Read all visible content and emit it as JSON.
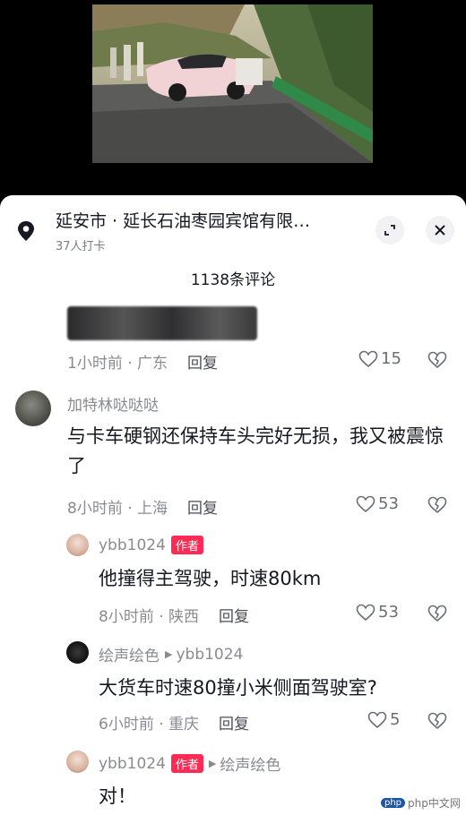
{
  "location": {
    "title": "延安市 · 延长石油枣园宾馆有限…",
    "subtitle": "37人打卡"
  },
  "comment_count": "1138条评论",
  "comments": [
    {
      "time": "1小时前 · 广东",
      "reply_label": "回复",
      "likes": "15"
    },
    {
      "username": "加特林哒哒哒",
      "text": "与卡车硬钢还保持车头完好无损，我又被震惊了",
      "time": "8小时前 · 上海",
      "reply_label": "回复",
      "likes": "53"
    },
    {
      "username": "ybb1024",
      "badge": "作者",
      "text": "他撞得主驾驶，时速80km",
      "time": "8小时前 · 陕西",
      "reply_label": "回复",
      "likes": "53"
    },
    {
      "username": "绘声绘色",
      "reply_to": "ybb1024",
      "text": "大货车时速80撞小米侧面驾驶室?",
      "time": "6小时前 · 重庆",
      "reply_label": "回复",
      "likes": "5"
    },
    {
      "username": "ybb1024",
      "badge": "作者",
      "reply_to": "绘声绘色",
      "text": "对！"
    }
  ],
  "watermark": "php中文网",
  "icons": [
    "location-pin-icon",
    "expand-icon",
    "close-icon",
    "heart-icon",
    "broken-heart-icon",
    "reply-arrow-icon"
  ]
}
